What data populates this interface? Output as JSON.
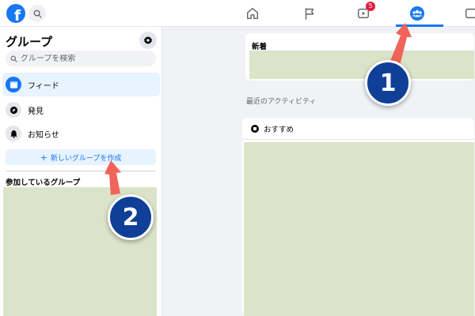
{
  "topbar": {
    "logo_letter": "f",
    "watch_badge": "5",
    "icons": [
      "facebook-logo",
      "search-icon",
      "home-icon",
      "flag-icon",
      "watch-icon",
      "groups-icon",
      "more-icon"
    ],
    "active_tab": "groups"
  },
  "sidebar": {
    "title": "グループ",
    "search_placeholder": "グループを検索",
    "items": [
      {
        "label": "フィード",
        "icon": "feed-icon",
        "active": true
      },
      {
        "label": "発見",
        "icon": "discover-icon",
        "active": false
      },
      {
        "label": "お知らせ",
        "icon": "bell-icon",
        "active": false
      }
    ],
    "create_button": "新しいグループを作成",
    "joined_section": "参加しているグループ"
  },
  "main": {
    "new_card_title": "新着",
    "recent_activity": "最近のアクティビティ",
    "recommended_title": "おすすめ"
  },
  "annotations": {
    "callout_1": "1",
    "callout_2": "2",
    "callout_color": "#0f3f97",
    "arrow_color": "#f0645a"
  },
  "colors": {
    "accent": "#1877f2",
    "placeholder": "#dbe3c8",
    "badge": "#e41e3f"
  }
}
